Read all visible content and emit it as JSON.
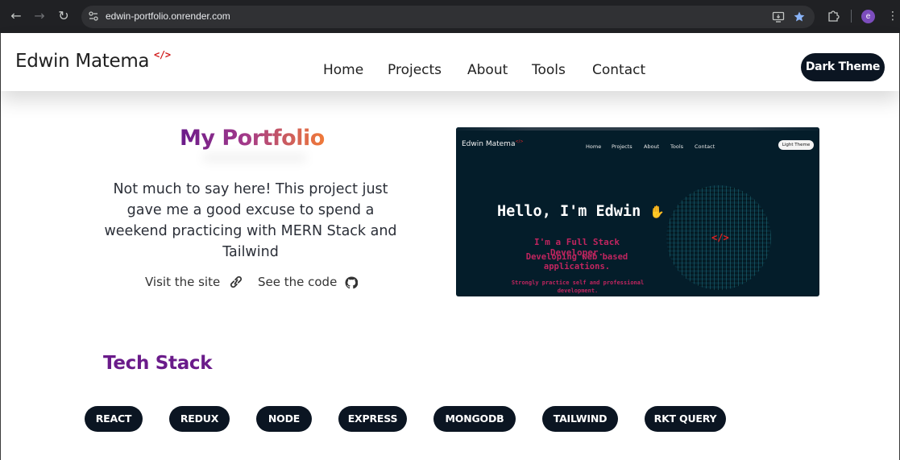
{
  "browser": {
    "url": "edwin-portfolio.onrender.com",
    "profile_initial": "e",
    "accent_color": "#8ab4f8"
  },
  "header": {
    "logo_text": "Edwin Matema",
    "logo_mark": "</>",
    "nav": [
      "Home",
      "Projects",
      "About",
      "Tools",
      "Contact"
    ],
    "theme_button": "Dark Theme"
  },
  "project": {
    "title": "My Portfolio",
    "description": "Not much to say here! This project just gave me a good excuse to spend a weekend practicing with MERN Stack and Tailwind",
    "visit_label": "Visit the site",
    "code_label": "See the code",
    "preview": {
      "logo": "Edwin Matema",
      "logo_mark": "</>",
      "nav": [
        "Home",
        "Projects",
        "About",
        "Tools",
        "Contact"
      ],
      "theme_button": "Light Theme",
      "hero": "Hello, I'm Edwin",
      "wave_icon": "waving-hand",
      "line1": "I'm a Full Stack Developer.",
      "line2": "Developing web based applications.",
      "line3": "Strongly practice self and professional development.",
      "code_mark": "</>"
    }
  },
  "tech": {
    "title": "Tech Stack",
    "items": [
      "REACT",
      "REDUX",
      "NODE",
      "EXPRESS",
      "MONGODB",
      "TAILWIND",
      "RKT QUERY"
    ]
  },
  "colors": {
    "brand_dark": "#0b1522",
    "title_purple": "#6a1b8a",
    "title_orange": "#f07a38",
    "accent_red": "#d11b1b"
  }
}
